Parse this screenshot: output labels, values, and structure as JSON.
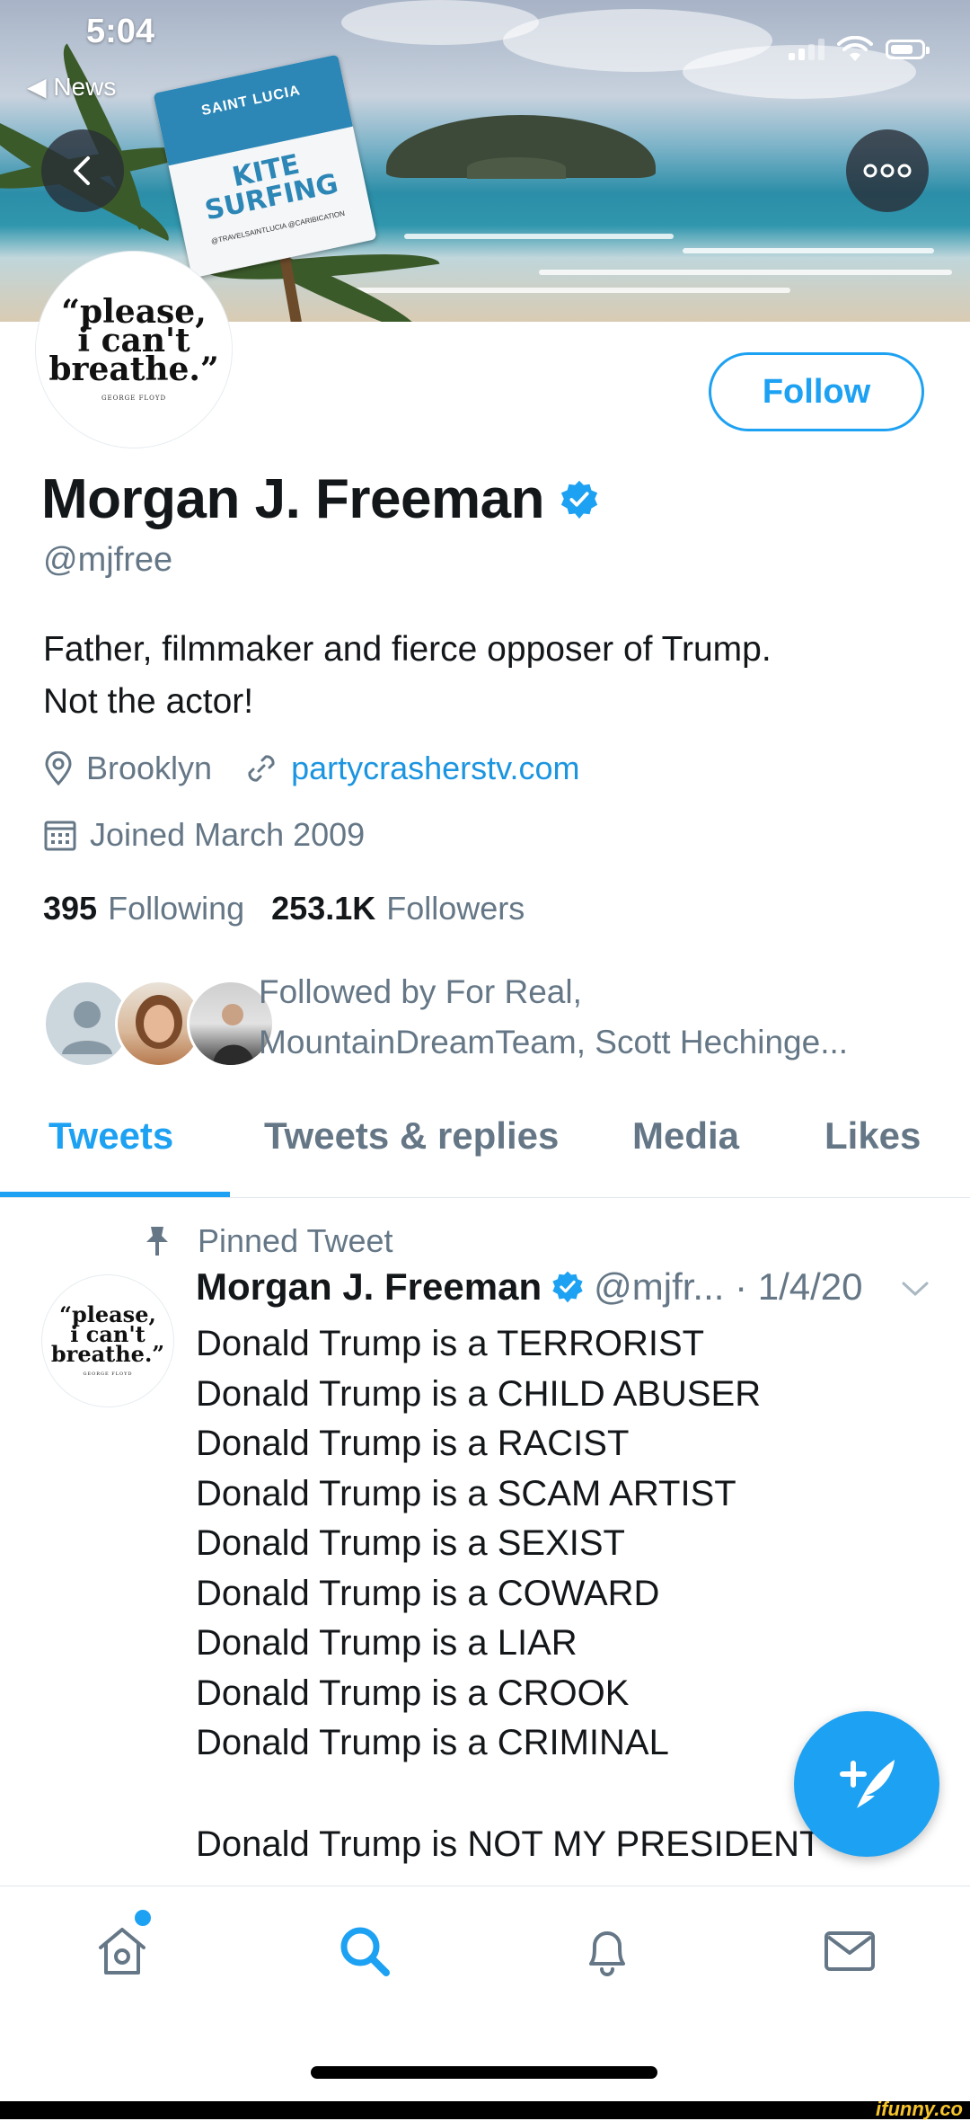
{
  "status_bar": {
    "time": "5:04",
    "back_label": "◀ News"
  },
  "banner": {
    "sign_top": "SAINT LUCIA",
    "sign_main_line1": "KITE",
    "sign_main_line2": "SURFING",
    "sign_footer": "@TRAVELSAINTLUCIA  @CARIBICATION"
  },
  "profile": {
    "avatar_quote_line1": "“please,",
    "avatar_quote_line2": "i can't",
    "avatar_quote_line3": "breathe.”",
    "avatar_attribution": "GEORGE FLOYD",
    "follow_label": "Follow",
    "display_name": "Morgan J. Freeman",
    "handle": "@mjfree",
    "bio_line1": "Father, filmmaker and fierce opposer of Trump.",
    "bio_line2": "Not the actor!",
    "location": "Brooklyn",
    "website": "partycrasherstv.com",
    "joined": "Joined March 2009",
    "following_count": "395",
    "following_label": "Following",
    "followers_count": "253.1K",
    "followers_label": "Followers",
    "followed_by_line1": "Followed by For Real,",
    "followed_by_line2": "MountainDreamTeam, Scott Hechinge..."
  },
  "tabs": [
    {
      "label": "Tweets",
      "active": true
    },
    {
      "label": "Tweets & replies",
      "active": false
    },
    {
      "label": "Media",
      "active": false
    },
    {
      "label": "Likes",
      "active": false
    }
  ],
  "tweet": {
    "pinned_label": "Pinned Tweet",
    "author": "Morgan J. Freeman",
    "handle_date": "@mjfr... · 1/4/20",
    "lines": [
      "Donald Trump is a TERRORIST",
      "Donald Trump is a CHILD ABUSER",
      "Donald Trump is a RACIST",
      "Donald Trump is a SCAM ARTIST",
      "Donald Trump is a SEXIST",
      "Donald Trump is a COWARD",
      "Donald Trump is a LIAR",
      "Donald Trump is a CROOK",
      "Donald Trump is a CRIMINAL",
      "",
      "Donald Trump is NOT MY PRESIDENT"
    ]
  },
  "bottom_nav": {
    "items": [
      "home-icon",
      "search-icon",
      "notifications-icon",
      "messages-icon"
    ]
  },
  "watermark": "ifunny.co",
  "colors": {
    "accent": "#1da1f2",
    "muted": "#657786",
    "text": "#14171a"
  }
}
